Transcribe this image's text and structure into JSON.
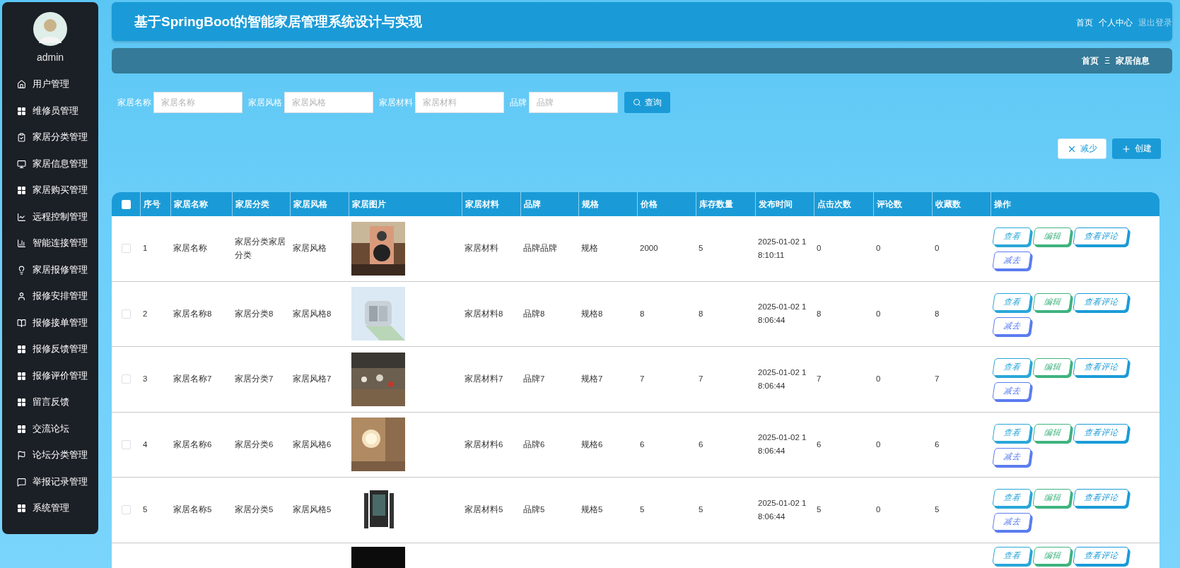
{
  "sidebar": {
    "user": "admin",
    "items": [
      "用户管理",
      "维修员管理",
      "家居分类管理",
      "家居信息管理",
      "家居购买管理",
      "远程控制管理",
      "智能连接管理",
      "家居报修管理",
      "报修安排管理",
      "报修接单管理",
      "报修反馈管理",
      "报修评价管理",
      "留言反馈",
      "交流论坛",
      "论坛分类管理",
      "举报记录管理",
      "系统管理"
    ]
  },
  "header": {
    "title": "基于SpringBoot的智能家居管理系统设计与实现",
    "nav": [
      {
        "label": "首页",
        "muted": false
      },
      {
        "label": "个人中心",
        "muted": false
      },
      {
        "label": "退出登录",
        "muted": true
      }
    ]
  },
  "breadcrumb": {
    "home": "首页",
    "separator": "Ξ",
    "current": "家居信息"
  },
  "search": {
    "fields": [
      {
        "label": "家居名称",
        "placeholder": "家居名称"
      },
      {
        "label": "家居风格",
        "placeholder": "家居风格"
      },
      {
        "label": "家居材料",
        "placeholder": "家居材料"
      },
      {
        "label": "品牌",
        "placeholder": "品牌"
      }
    ],
    "button": "查询"
  },
  "toolbar": [
    {
      "kind": "remove",
      "label": "减少"
    },
    {
      "kind": "create",
      "label": "创建"
    }
  ],
  "table": {
    "header_checked": false,
    "columns": [
      "序号",
      "家居名称",
      "家居分类",
      "家居风格",
      "家居图片",
      "家居材料",
      "品牌",
      "规格",
      "价格",
      "库存数量",
      "发布时间",
      "点击次数",
      "评论数",
      "收藏数",
      "操作"
    ],
    "rows": [
      {
        "checked": false,
        "cells": [
          "1",
          "家居名称",
          "家居分类家居分类",
          "家居风格"
        ],
        "more": [
          "家居材料",
          "品牌品牌",
          "规格",
          "2000",
          "5",
          "2025-01-02 18:10:11",
          "0",
          "0",
          "0"
        ],
        "actions": [
          {
            "kind": "view",
            "label": "查看"
          },
          {
            "kind": "edit",
            "label": "编辑"
          },
          {
            "kind": "comments",
            "label": "查看评论"
          },
          {
            "kind": "remove",
            "label": "减去"
          }
        ]
      },
      {
        "checked": false,
        "cells": [
          "2",
          "家居名称8",
          "家居分类8",
          "家居风格8"
        ],
        "more": [
          "家居材料8",
          "品牌8",
          "规格8",
          "8",
          "8",
          "2025-01-02 18:06:44",
          "8",
          "0",
          "8"
        ],
        "actions": [
          {
            "kind": "view",
            "label": "查看"
          },
          {
            "kind": "edit",
            "label": "编辑"
          },
          {
            "kind": "comments",
            "label": "查看评论"
          },
          {
            "kind": "remove",
            "label": "减去"
          }
        ]
      },
      {
        "checked": false,
        "cells": [
          "3",
          "家居名称7",
          "家居分类7",
          "家居风格7"
        ],
        "more": [
          "家居材料7",
          "品牌7",
          "规格7",
          "7",
          "7",
          "2025-01-02 18:06:44",
          "7",
          "0",
          "7"
        ],
        "actions": [
          {
            "kind": "view",
            "label": "查看"
          },
          {
            "kind": "edit",
            "label": "编辑"
          },
          {
            "kind": "comments",
            "label": "查看评论"
          },
          {
            "kind": "remove",
            "label": "减去"
          }
        ]
      },
      {
        "checked": false,
        "cells": [
          "4",
          "家居名称6",
          "家居分类6",
          "家居风格6"
        ],
        "more": [
          "家居材料6",
          "品牌6",
          "规格6",
          "6",
          "6",
          "2025-01-02 18:06:44",
          "6",
          "0",
          "6"
        ],
        "actions": [
          {
            "kind": "view",
            "label": "查看"
          },
          {
            "kind": "edit",
            "label": "编辑"
          },
          {
            "kind": "comments",
            "label": "查看评论"
          },
          {
            "kind": "remove",
            "label": "减去"
          }
        ]
      },
      {
        "checked": false,
        "cells": [
          "5",
          "家居名称5",
          "家居分类5",
          "家居风格5"
        ],
        "more": [
          "家居材料5",
          "品牌5",
          "规格5",
          "5",
          "5",
          "2025-01-02 18:06:44",
          "5",
          "0",
          "5"
        ],
        "actions": [
          {
            "kind": "view",
            "label": "查看"
          },
          {
            "kind": "edit",
            "label": "编辑"
          },
          {
            "kind": "comments",
            "label": "查看评论"
          },
          {
            "kind": "remove",
            "label": "减去"
          }
        ]
      }
    ],
    "partial_row": {
      "actions": [
        {
          "kind": "view",
          "label": "查看"
        },
        {
          "kind": "edit",
          "label": "编辑"
        },
        {
          "kind": "comments",
          "label": "查看评论"
        }
      ]
    }
  }
}
